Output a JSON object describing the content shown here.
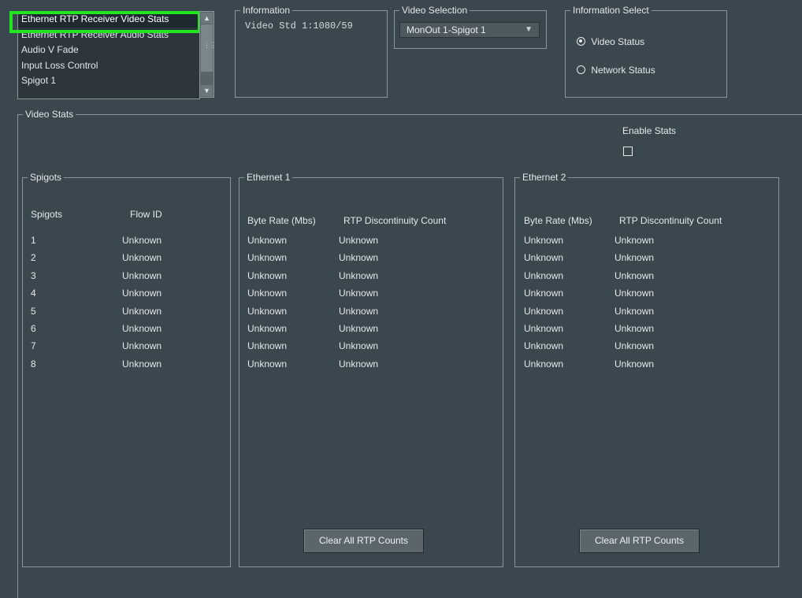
{
  "menu": {
    "items": [
      "Ethernet RTP Receiver Video Stats",
      "Ethernet RTP Receiver Audio Stats",
      "Audio V Fade",
      "Input Loss Control",
      "Spigot 1"
    ],
    "selected_index": 0
  },
  "information": {
    "legend": "Information",
    "value": "Video Std 1:1080/59"
  },
  "video_selection": {
    "legend": "Video Selection",
    "value": "MonOut 1-Spigot 1"
  },
  "information_select": {
    "legend": "Information Select",
    "options": [
      "Video Status",
      "Network Status"
    ],
    "selected": "Video Status"
  },
  "video_stats": {
    "legend": "Video Stats",
    "enable_stats_label": "Enable Stats",
    "enable_stats_checked": false,
    "spigots": {
      "legend": "Spigots",
      "headers": [
        "Spigots",
        "Flow ID"
      ],
      "rows": [
        [
          "1",
          "Unknown"
        ],
        [
          "2",
          "Unknown"
        ],
        [
          "3",
          "Unknown"
        ],
        [
          "4",
          "Unknown"
        ],
        [
          "5",
          "Unknown"
        ],
        [
          "6",
          "Unknown"
        ],
        [
          "7",
          "Unknown"
        ],
        [
          "8",
          "Unknown"
        ]
      ]
    },
    "ethernet1": {
      "legend": "Ethernet 1",
      "headers": [
        "Byte Rate (Mbs)",
        "RTP Discontinuity Count"
      ],
      "rows": [
        [
          "Unknown",
          "Unknown"
        ],
        [
          "Unknown",
          "Unknown"
        ],
        [
          "Unknown",
          "Unknown"
        ],
        [
          "Unknown",
          "Unknown"
        ],
        [
          "Unknown",
          "Unknown"
        ],
        [
          "Unknown",
          "Unknown"
        ],
        [
          "Unknown",
          "Unknown"
        ],
        [
          "Unknown",
          "Unknown"
        ]
      ],
      "clear_button": "Clear All RTP Counts"
    },
    "ethernet2": {
      "legend": "Ethernet 2",
      "headers": [
        "Byte Rate (Mbs)",
        "RTP Discontinuity Count"
      ],
      "rows": [
        [
          "Unknown",
          "Unknown"
        ],
        [
          "Unknown",
          "Unknown"
        ],
        [
          "Unknown",
          "Unknown"
        ],
        [
          "Unknown",
          "Unknown"
        ],
        [
          "Unknown",
          "Unknown"
        ],
        [
          "Unknown",
          "Unknown"
        ],
        [
          "Unknown",
          "Unknown"
        ],
        [
          "Unknown",
          "Unknown"
        ]
      ],
      "clear_button": "Clear All RTP Counts"
    }
  },
  "colors": {
    "background": "#3b474e",
    "highlight": "#22e61e",
    "border": "#8a969c"
  }
}
